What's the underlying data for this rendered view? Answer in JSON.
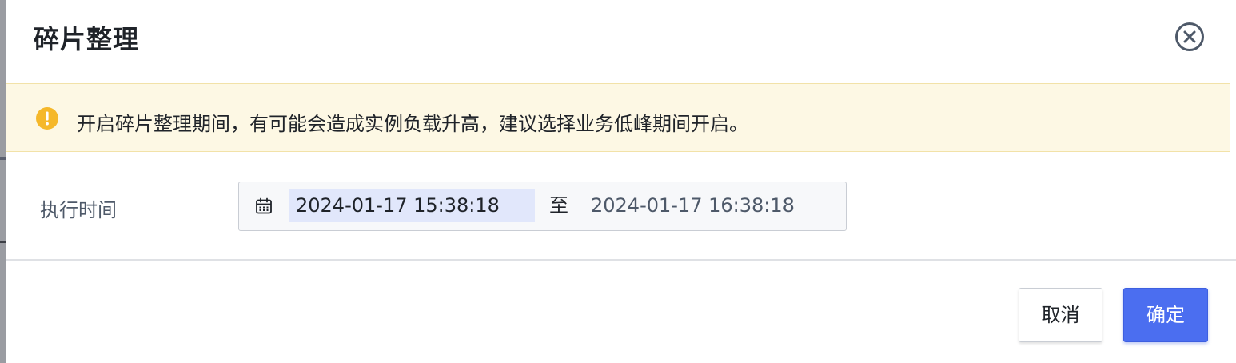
{
  "dialog": {
    "title": "碎片整理",
    "close_icon": "close-circle-icon"
  },
  "alert": {
    "icon": "exclamation-circle-icon",
    "color": "#f5b82a",
    "text": "开启碎片整理期间，有可能会造成实例负载升高，建议选择业务低峰期间开启。"
  },
  "form": {
    "exec_time_label": "执行时间",
    "range": {
      "icon": "calendar-icon",
      "start": "2024-01-17 15:38:18",
      "separator": "至",
      "end": "2024-01-17 16:38:18"
    }
  },
  "footer": {
    "cancel_label": "取消",
    "ok_label": "确定",
    "accent_color": "#4b6ef0"
  }
}
